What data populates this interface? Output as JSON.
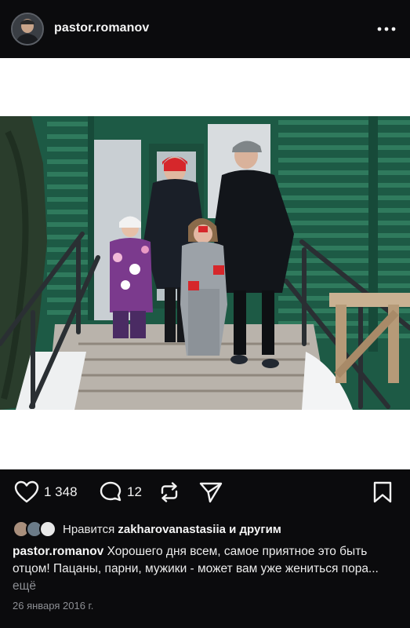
{
  "post": {
    "username": "pastor.romanov",
    "more_icon": "more-horizontal-icon"
  },
  "actions": {
    "likes_count": "1 348",
    "comments_count": "12"
  },
  "liked_by": {
    "prefix": "Нравится",
    "user": "zakharovanastasiia",
    "suffix": "и другим"
  },
  "caption": {
    "username": "pastor.romanov",
    "text": "Хорошего дня всем, самое приятное это быть отцом! Пацаны, парни, мужики - может вам уже жениться пора...",
    "more": "ещё"
  },
  "date": "26 января 2016 г.",
  "colors": {
    "background": "#0b0b0d",
    "text": "#f2f2f2",
    "muted": "#8d8f94",
    "building_green": "#1f5e48"
  }
}
